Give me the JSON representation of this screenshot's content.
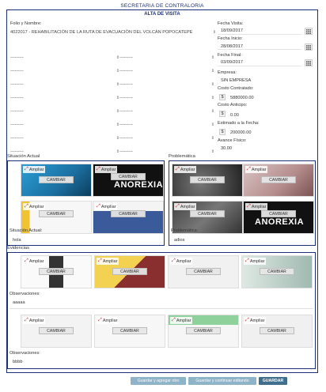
{
  "header": {
    "title": "SECRETARIA DE CONTRALORIA",
    "subtitle": "ALTA DE VISITA"
  },
  "form": {
    "folio_label": "Folio y Nombre:",
    "folio_value": "4022017 - REHABILITACIÓN DE LA RUTA DE EVACUACIÓN DEL VOLCÁN POPOCATEPE",
    "dash": "---------",
    "fecha_visita_label": "Fecha Visita:",
    "fecha_visita": "18/09/2017",
    "fecha_inicio_label": "Fecha Inicio:",
    "fecha_inicio": "28/08/2017",
    "fecha_final_label": "Fecha Final:",
    "fecha_final": "03/09/2017",
    "empresa_label": "Empresa:",
    "empresa": "SIN EMPRESA",
    "costo_contratado_label": "Costo Contratado:",
    "costo_contratado": "5880000.00",
    "costo_anticipo_label": "Costo Anticipo:",
    "costo_anticipo": "0.00",
    "estimado_label": "Estimado a la Fecha:",
    "estimado": "200000.00",
    "avance_label": "Avance Físico:",
    "avance": "30.00",
    "currency": "$"
  },
  "situacion": {
    "title": "Situación Actual",
    "field_label": "Situación Actual:",
    "field_value": "hola"
  },
  "problematica": {
    "title": "Problemática",
    "field_label": "Problemática:",
    "field_value": "adios"
  },
  "evidencias": {
    "title": "Evidencias",
    "obs_label": "Observaciones:",
    "obs1": "aaaaa",
    "obs2": "bbbb"
  },
  "thumb": {
    "ampliar": "Ampliar",
    "cambiar": "CAMBIAR"
  },
  "thumb_texts": {
    "anorexia": "ANOREXIA"
  },
  "actions": {
    "save_add": "Guardar y agregar otro",
    "save_continue": "Guardar y continuar editando",
    "save": "GUARDAR"
  }
}
